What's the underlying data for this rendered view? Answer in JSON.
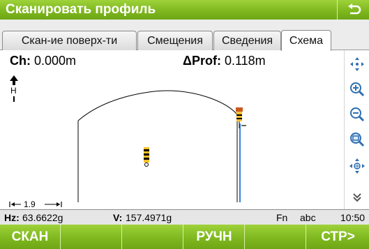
{
  "app": {
    "title": "Сканировать профиль",
    "back_icon": "return-arrow-icon"
  },
  "tabs": [
    {
      "label": "Скан-ие поверх-ти",
      "active": false
    },
    {
      "label": "Смещения",
      "active": false
    },
    {
      "label": "Сведения",
      "active": false
    },
    {
      "label": "Схема",
      "active": true
    }
  ],
  "readouts": {
    "ch_label": "Ch:",
    "ch_value": "0.000m",
    "dprof_label": "ΔProf:",
    "dprof_value": "0.118m"
  },
  "plot": {
    "north_label": "H",
    "scale_label": "1.9",
    "profile_color": "#000000",
    "vertical_color": "#3a7fd8"
  },
  "side_toolbar": [
    {
      "name": "pan-icon"
    },
    {
      "name": "zoom-in-icon"
    },
    {
      "name": "zoom-out-icon"
    },
    {
      "name": "zoom-extent-icon"
    },
    {
      "name": "center-on-point-icon"
    },
    {
      "name": "scroll-down-icon"
    }
  ],
  "status": {
    "hz_label": "Hz:",
    "hz_value": "63.6622g",
    "v_label": "V:",
    "v_value": "157.4971g",
    "fn": "Fn",
    "input_mode": "abc",
    "time": "10:50"
  },
  "softkeys": [
    "СКАН",
    "",
    "",
    "РУЧН",
    "",
    "СТР>"
  ],
  "colors": {
    "accent_green": "#8cc63f",
    "text_white": "#ffffff"
  }
}
